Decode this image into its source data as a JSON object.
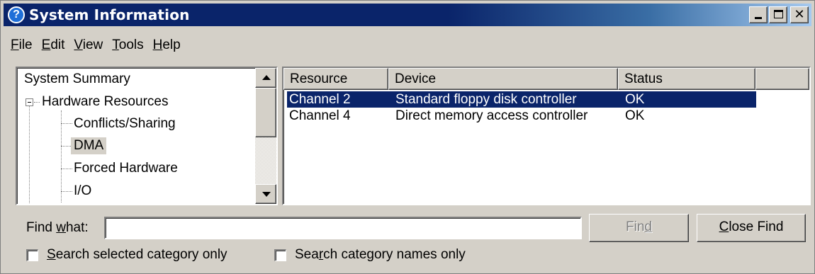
{
  "window": {
    "title": "System Information",
    "app_icon_glyph": "?"
  },
  "menu": [
    {
      "label": "File",
      "accel": "F",
      "rest": "ile"
    },
    {
      "label": "Edit",
      "accel": "E",
      "rest": "dit"
    },
    {
      "label": "View",
      "accel": "V",
      "rest": "iew"
    },
    {
      "label": "Tools",
      "accel": "T",
      "rest": "ools"
    },
    {
      "label": "Help",
      "accel": "H",
      "rest": "elp"
    }
  ],
  "tree": {
    "items": [
      {
        "label": "System Summary"
      },
      {
        "label": "Hardware Resources"
      },
      {
        "label": "Conflicts/Sharing"
      },
      {
        "label": "DMA"
      },
      {
        "label": "Forced Hardware"
      },
      {
        "label": "I/O"
      }
    ],
    "selected": "DMA"
  },
  "list": {
    "columns": [
      "Resource",
      "Device",
      "Status"
    ],
    "rows": [
      {
        "resource": "Channel 2",
        "device": "Standard floppy disk controller",
        "status": "OK"
      },
      {
        "resource": "Channel 4",
        "device": "Direct memory access controller",
        "status": "OK"
      }
    ]
  },
  "find": {
    "label_pre": "Find ",
    "label_accel": "w",
    "label_post": "hat:",
    "value": "",
    "find_button_pre": "Fin",
    "find_button_accel": "d",
    "close_button_accel": "C",
    "close_button_post": "lose Find"
  },
  "options": {
    "selected_only_accel": "S",
    "selected_only_post": "earch selected category only",
    "names_only_pre": "Sea",
    "names_only_accel": "r",
    "names_only_post": "ch category names only"
  },
  "colors": {
    "title_bar": "#0a246a",
    "face": "#d4d0c8",
    "selection": "#0a246a"
  }
}
